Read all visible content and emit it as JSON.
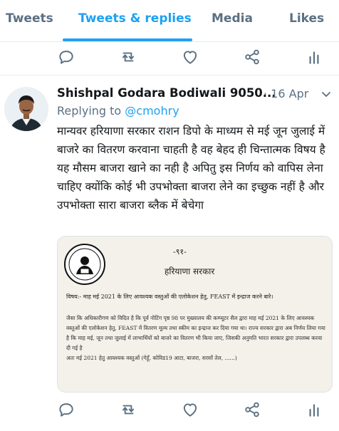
{
  "tabs": [
    {
      "label": "Tweets"
    },
    {
      "label": "Tweets & replies"
    },
    {
      "label": "Media"
    },
    {
      "label": "Likes"
    }
  ],
  "icons": {
    "reply": "reply-icon",
    "retweet": "retweet-icon",
    "like": "heart-icon",
    "share": "share-icon",
    "analytics": "analytics-icon"
  },
  "colors": {
    "accent": "#1da1f2",
    "muted": "#5b7083",
    "text": "#14171a",
    "divider": "#e6ecf0"
  },
  "tweet": {
    "author": "Shishpal Godara Bodiwali 9050...",
    "date": "· 16 Apr",
    "replying_prefix": "Replying to ",
    "replying_handle": "@cmohry",
    "text": "मान्यवर हरियाणा सरकार राशन डिपो के माध्यम से मई जून जुलाई में बाजरे का वितरण करवाना चाहती है वह बेहद ही चिन्तात्मक विषय है यह मौसम बाजरा खाने का नही है अपितु इस निर्णय को वापिस लेना चाहिए क्योंकि कोई भी उपभोक्ता बाजरा लेने का इच्छुक नहीं है और उपभोक्ता सारा बाजरा ब्लैक में बेचेगा",
    "image": {
      "number": "-९१-",
      "org": "हरियाणा सरकार",
      "subject": "विषय:- माह मई 2021 के लिए आवश्यक वस्तुओं की एलोकेशन हेतु, FEAST में इन्द्राज करने बारे।",
      "para1": "जैसा कि अधिकारीगण को विदित है कि पूर्व नोटिंग पृष्ठ 98 पर मुख्यालय की कम्प्यूटर सैल द्वारा माह मई 2021 के लिए आवश्यक वस्तुओं की एलोकेशन हेतु, FEAST में वितरण मूल्य तथा स्कीम का इन्द्राज कर दिया गया था। राज्य सरकार द्वारा अब निर्णय लिया गया है कि माह मई, जून तथा जुलाई में लाभार्थियों को बाजरे का वितरण भी किया जाए, जिसकी अनुमति भारत सरकार द्वारा उपलब्ध करवा दी गई है",
      "para2": "अतः मई 2021 हेतु आवश्यक वस्तुओं (गेहूँ, कोविड19 आटा, बाजरा, सरसों तेल, ......)"
    }
  }
}
